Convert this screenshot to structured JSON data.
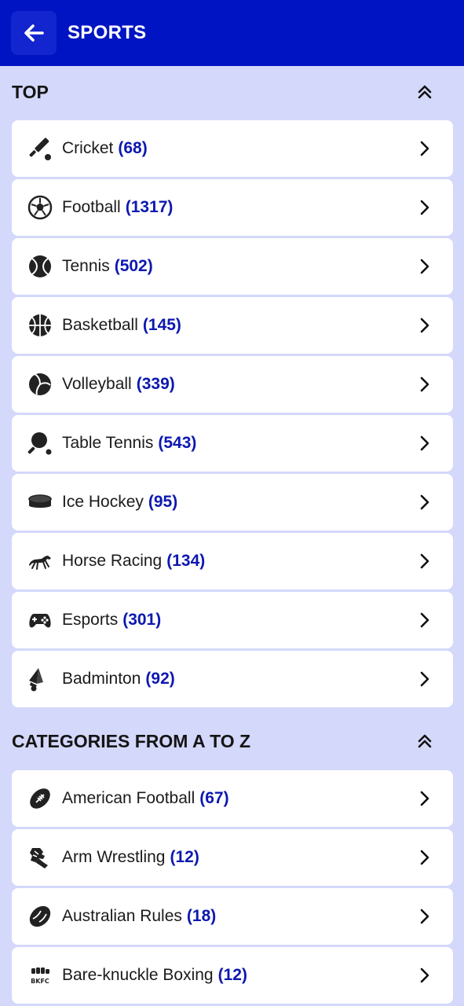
{
  "header": {
    "title": "SPORTS"
  },
  "top": {
    "title": "TOP",
    "items": [
      {
        "label": "Cricket",
        "count": "(68)",
        "icon": "cricket-icon"
      },
      {
        "label": "Football",
        "count": "(1317)",
        "icon": "football-icon"
      },
      {
        "label": "Tennis",
        "count": "(502)",
        "icon": "tennis-icon"
      },
      {
        "label": "Basketball",
        "count": "(145)",
        "icon": "basketball-icon"
      },
      {
        "label": "Volleyball",
        "count": "(339)",
        "icon": "volleyball-icon"
      },
      {
        "label": "Table Tennis",
        "count": "(543)",
        "icon": "table-tennis-icon"
      },
      {
        "label": "Ice Hockey",
        "count": "(95)",
        "icon": "ice-hockey-icon"
      },
      {
        "label": "Horse Racing",
        "count": "(134)",
        "icon": "horse-racing-icon"
      },
      {
        "label": "Esports",
        "count": "(301)",
        "icon": "esports-icon"
      },
      {
        "label": "Badminton",
        "count": "(92)",
        "icon": "badminton-icon"
      }
    ]
  },
  "categories": {
    "title": "CATEGORIES FROM A TO Z",
    "items": [
      {
        "label": "American Football",
        "count": "(67)",
        "icon": "american-football-icon"
      },
      {
        "label": "Arm Wrestling",
        "count": "(12)",
        "icon": "arm-wrestling-icon"
      },
      {
        "label": "Australian Rules",
        "count": "(18)",
        "icon": "australian-rules-icon"
      },
      {
        "label": "Bare-knuckle Boxing",
        "count": "(12)",
        "icon": "bkfc-icon",
        "icon_text": "BKFC"
      }
    ]
  },
  "colors": {
    "header_bg": "#0014c4",
    "page_bg": "#d4d8fa",
    "count_text": "#0d18b0"
  }
}
